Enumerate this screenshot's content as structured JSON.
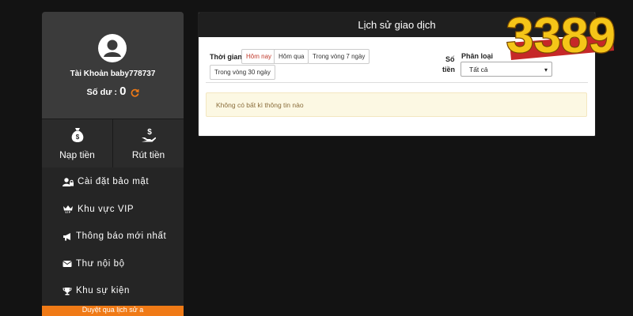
{
  "sidebar": {
    "account_label": "Tài Khoản baby778737",
    "balance_label": "Số dư :",
    "balance_value": "0",
    "deposit_label": "Nạp tiền",
    "withdraw_label": "Rút tiền",
    "menu": [
      {
        "label": "Cài đặt bảo mật",
        "icon": "user-lock-icon"
      },
      {
        "label": "Khu vực VIP",
        "icon": "vip-crown-icon"
      },
      {
        "label": "Thông báo mới nhất",
        "icon": "megaphone-icon"
      },
      {
        "label": "Thư nội bộ",
        "icon": "envelope-icon"
      },
      {
        "label": "Khu sự kiện",
        "icon": "trophy-icon"
      }
    ],
    "bottom_bar": "Duyệt qua lịch sử a"
  },
  "panel": {
    "title": "Lịch sử giao dịch",
    "time_label": "Thời gian",
    "time_options": [
      "Hôm nay",
      "Hôm qua",
      "Trong vòng 7 ngày",
      "Trong vòng 30 ngày"
    ],
    "amount_label_1": "Số",
    "amount_label_2": "tiền",
    "category_label": "Phân loại",
    "category_selected": "Tất cả",
    "empty_notice": "Không có bất kì thông tin nào"
  },
  "logo": {
    "text": "3389"
  },
  "colors": {
    "accent": "#f07a16",
    "background": "#131313",
    "logo_fill": "#f5c518",
    "logo_ribbon": "#c62828"
  }
}
